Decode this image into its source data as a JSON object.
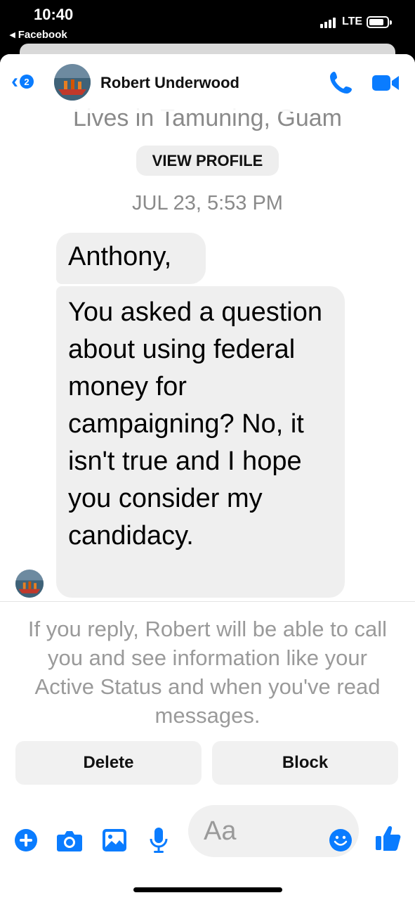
{
  "status_bar": {
    "time": "10:40",
    "back_app": "◂ Facebook",
    "network": "LTE"
  },
  "header": {
    "back_badge": "2",
    "contact_name": "Robert Underwood"
  },
  "profile": {
    "location": "Lives in Tamuning, Guam",
    "view_profile_label": "VIEW PROFILE"
  },
  "conversation": {
    "timestamp": "JUL 23, 5:53 PM",
    "messages": [
      {
        "text": "Anthony,"
      },
      {
        "text": "You asked a question about using federal money for campaigning? No, it isn't true and I hope you consider my candidacy."
      }
    ]
  },
  "message_request": {
    "notice": "If you reply, Robert will be able to call you and see information like your Active Status and when you've read messages.",
    "delete_label": "Delete",
    "block_label": "Block"
  },
  "composer": {
    "placeholder": "Aa"
  },
  "colors": {
    "accent": "#0a7cff",
    "bubble": "#efefef",
    "muted_text": "#8a8a8a"
  },
  "icons": [
    "back-chevron-icon",
    "phone-icon",
    "video-camera-icon",
    "plus-icon",
    "camera-icon",
    "image-icon",
    "microphone-icon",
    "emoji-icon",
    "thumbs-up-icon"
  ]
}
